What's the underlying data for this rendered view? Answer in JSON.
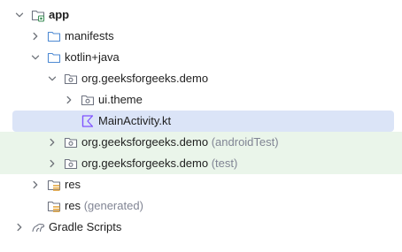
{
  "project_tree": {
    "items": [
      {
        "label": "app",
        "suffix": "",
        "expanded": true,
        "icon": "module-folder-icon"
      },
      {
        "label": "manifests",
        "suffix": "",
        "expanded": false,
        "icon": "folder-icon"
      },
      {
        "label": "kotlin+java",
        "suffix": "",
        "expanded": true,
        "icon": "folder-icon"
      },
      {
        "label": "org.geeksforgeeks.demo",
        "suffix": "",
        "expanded": true,
        "icon": "package-icon"
      },
      {
        "label": "ui.theme",
        "suffix": "",
        "expanded": false,
        "icon": "package-icon"
      },
      {
        "label": "MainActivity.kt",
        "suffix": "",
        "selected": true,
        "icon": "kotlin-file-icon"
      },
      {
        "label": "org.geeksforgeeks.demo",
        "suffix": "(androidTest)",
        "expanded": false,
        "icon": "package-icon"
      },
      {
        "label": "org.geeksforgeeks.demo",
        "suffix": "(test)",
        "expanded": false,
        "icon": "package-icon"
      },
      {
        "label": "res",
        "suffix": "",
        "expanded": false,
        "icon": "resources-folder-icon"
      },
      {
        "label": "res",
        "suffix": "(generated)",
        "icon": "resources-folder-icon"
      },
      {
        "label": "Gradle Scripts",
        "suffix": "",
        "expanded": false,
        "icon": "gradle-icon"
      }
    ]
  },
  "colors": {
    "selection": "#dbe4f7",
    "test_highlight": "#eaf5ea",
    "folder_outline": "#4e8ad3",
    "package_outline": "#6e7380",
    "suffix_text": "#818594",
    "resources_accent": "#e4a233"
  }
}
